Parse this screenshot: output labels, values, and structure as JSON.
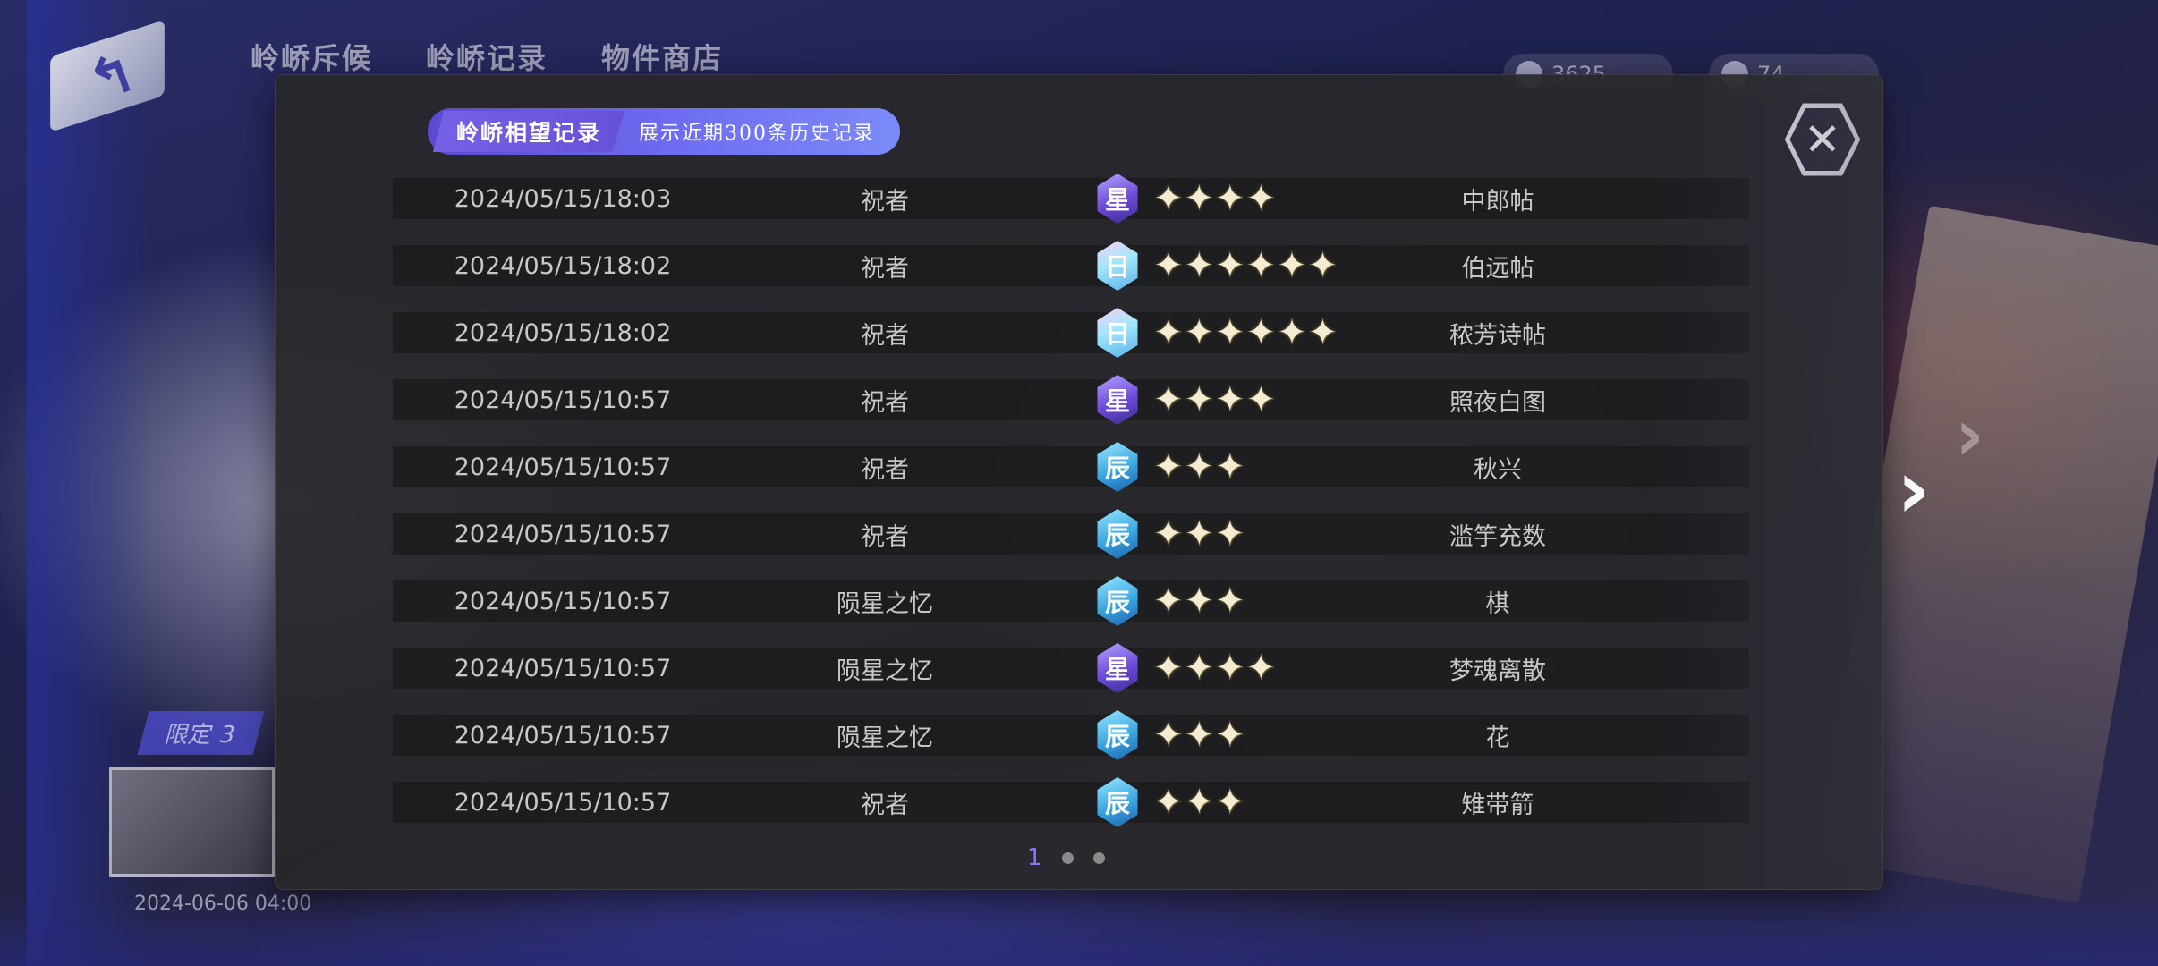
{
  "background": {
    "top_tabs": [
      "岭峤斥候",
      "岭峤记录",
      "物件商店"
    ],
    "hud_values": [
      "3625",
      "74"
    ],
    "event_label": "限定 3",
    "event_date": "2024-06-06 04:00"
  },
  "header": {
    "title": "岭峤相望记录",
    "subtitle": "展示近期300条历史记录"
  },
  "colors": {
    "accent": "#6f6ef2",
    "rank_xing": "#6c49d9",
    "rank_ri": "#9fe6ff",
    "rank_chen": "#3aa6e0"
  },
  "records": [
    {
      "time": "2024/05/15/18:03",
      "pool": "祝者",
      "rank": "星",
      "rank_type": "xing",
      "stars": 4,
      "name": "中郎帖"
    },
    {
      "time": "2024/05/15/18:02",
      "pool": "祝者",
      "rank": "日",
      "rank_type": "ri",
      "stars": 6,
      "name": "伯远帖"
    },
    {
      "time": "2024/05/15/18:02",
      "pool": "祝者",
      "rank": "日",
      "rank_type": "ri",
      "stars": 6,
      "name": "秾芳诗帖"
    },
    {
      "time": "2024/05/15/10:57",
      "pool": "祝者",
      "rank": "星",
      "rank_type": "xing",
      "stars": 4,
      "name": "照夜白图"
    },
    {
      "time": "2024/05/15/10:57",
      "pool": "祝者",
      "rank": "辰",
      "rank_type": "chen",
      "stars": 3,
      "name": "秋兴"
    },
    {
      "time": "2024/05/15/10:57",
      "pool": "祝者",
      "rank": "辰",
      "rank_type": "chen",
      "stars": 3,
      "name": "滥竽充数"
    },
    {
      "time": "2024/05/15/10:57",
      "pool": "陨星之忆",
      "rank": "辰",
      "rank_type": "chen",
      "stars": 3,
      "name": "棋"
    },
    {
      "time": "2024/05/15/10:57",
      "pool": "陨星之忆",
      "rank": "星",
      "rank_type": "xing",
      "stars": 4,
      "name": "梦魂离散"
    },
    {
      "time": "2024/05/15/10:57",
      "pool": "陨星之忆",
      "rank": "辰",
      "rank_type": "chen",
      "stars": 3,
      "name": "花"
    },
    {
      "time": "2024/05/15/10:57",
      "pool": "祝者",
      "rank": "辰",
      "rank_type": "chen",
      "stars": 3,
      "name": "雉带箭"
    }
  ],
  "pagination": {
    "current": "1",
    "total_pages": 3
  },
  "icons": {
    "close": "close-icon",
    "back": "back-arrow-icon",
    "next": "chevron-right-icon",
    "star": "star-icon"
  }
}
